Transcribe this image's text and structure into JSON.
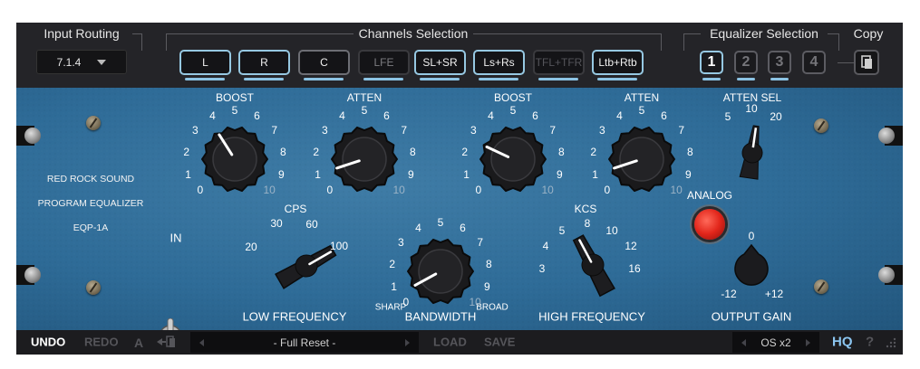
{
  "header": {
    "input_routing_title": "Input Routing",
    "routing_value": "7.1.4",
    "channels_title": "Channels Selection",
    "channels": [
      {
        "label": "L",
        "state": "active"
      },
      {
        "label": "R",
        "state": "active"
      },
      {
        "label": "C",
        "state": "normal"
      },
      {
        "label": "LFE",
        "state": "dim"
      },
      {
        "label": "SL+SR",
        "state": "active"
      },
      {
        "label": "Ls+Rs",
        "state": "active"
      },
      {
        "label": "TFL+TFR",
        "state": "off"
      },
      {
        "label": "Ltb+Rtb",
        "state": "active"
      }
    ],
    "equalizer_title": "Equalizer Selection",
    "equalizers": [
      "1",
      "2",
      "3",
      "4"
    ],
    "equalizer_selected": "1",
    "copy_title": "Copy",
    "copy_icon": "copy-icon"
  },
  "panel": {
    "brand_line1": "RED ROCK SOUND",
    "brand_line2": "PROGRAM EQUALIZER",
    "brand_line3": "EQP-1A",
    "in_label": "IN",
    "boost_label": "BOOST",
    "atten_label": "ATTEN",
    "atten_sel_label": "ATTEN SEL",
    "cps_label": "CPS",
    "kcs_label": "KCS",
    "analog_label": "ANALOG",
    "low_frequency_label": "LOW FREQUENCY",
    "bandwidth_label": "BANDWIDTH",
    "sharp_label": "SHARP",
    "broad_label": "BROAD",
    "high_frequency_label": "HIGH FREQUENCY",
    "output_gain_label": "OUTPUT GAIN",
    "scale": [
      "0",
      "1",
      "2",
      "3",
      "4",
      "5",
      "6",
      "7",
      "8",
      "9",
      "10"
    ],
    "cps_values": [
      "20",
      "30",
      "60",
      "100"
    ],
    "kcs_values": [
      "3",
      "4",
      "5",
      "8",
      "10",
      "12",
      "16"
    ],
    "atten_sel_values": [
      "5",
      "10",
      "20"
    ],
    "gain_values": [
      "0",
      "-12",
      "+12"
    ],
    "knob_values": {
      "low_boost": 3.8,
      "low_atten": 1.0,
      "high_boost": 2.6,
      "high_atten": 1.0,
      "bandwidth": 0.6,
      "atten_sel": "10",
      "low_frequency": "100",
      "high_frequency": "5",
      "output_gain": 0
    },
    "analog_state": "on"
  },
  "footer": {
    "undo": "UNDO",
    "redo": "REDO",
    "ab": "A",
    "ab_copy_icon": "ab-copy-icon",
    "preset": "- Full Reset -",
    "load": "LOAD",
    "save": "SAVE",
    "oversampling": "OS x2",
    "hq": "HQ",
    "help": "?",
    "resize_icon": "resize-grip-icon"
  }
}
